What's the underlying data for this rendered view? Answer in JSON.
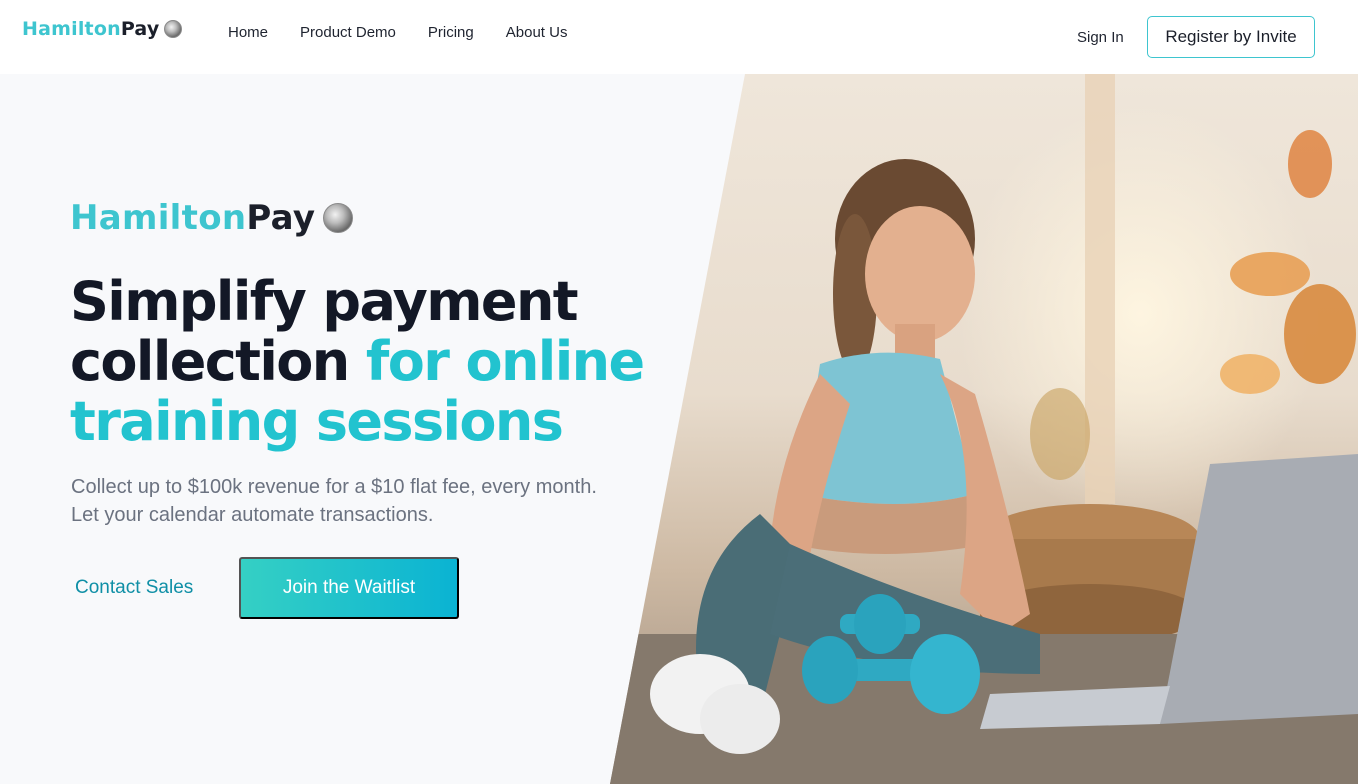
{
  "nav": {
    "logo_part1": "Hamilton",
    "logo_part2": "Pay",
    "links": [
      "Home",
      "Product Demo",
      "Pricing",
      "About Us"
    ],
    "signin_label": "Sign In",
    "register_label": "Register by Invite"
  },
  "hero": {
    "logo_part1": "Hamilton",
    "logo_part2": "Pay",
    "headline_line1": "Simplify payment",
    "headline_line2a": "collection ",
    "headline_line2b": "for online",
    "headline_line3": "training sessions",
    "subtext_line1": "Collect up to $100k revenue for a $10 flat fee, every month.",
    "subtext_line2": "Let your calendar automate transactions.",
    "contact_label": "Contact Sales",
    "join_label": "Join the Waitlist"
  },
  "colors": {
    "brand_teal": "#3ec5cf",
    "headline_accent": "#22c3cf",
    "dark_text": "#131826",
    "button_gradient_start": "#35d0c4",
    "button_gradient_end": "#0ab3d3"
  },
  "icons": {
    "logo_coin": "coin-icon"
  }
}
